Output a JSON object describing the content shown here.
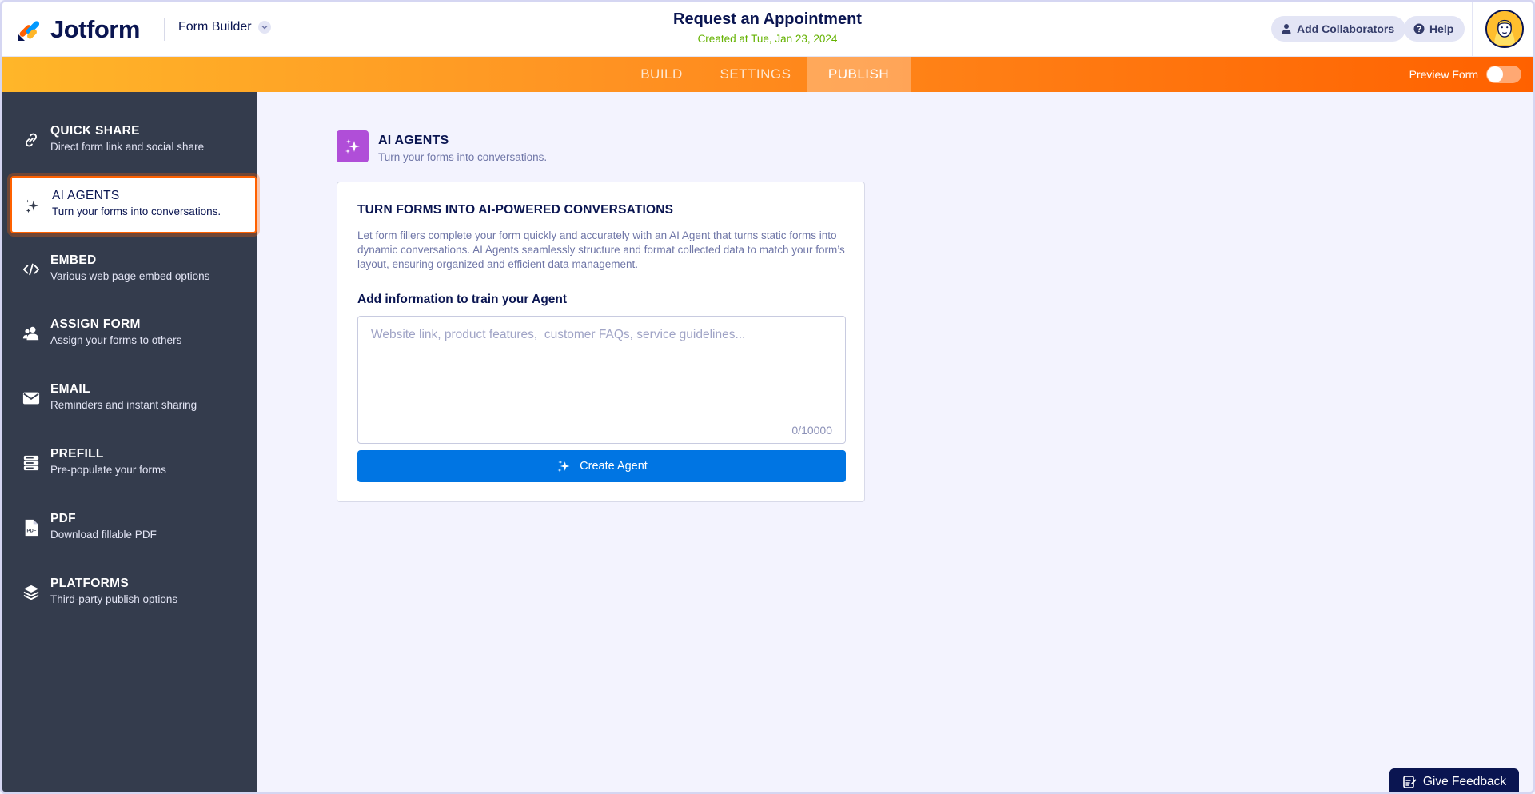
{
  "header": {
    "logo_text": "Jotform",
    "app_switcher": "Form Builder",
    "form_title": "Request an Appointment",
    "form_created": "Created at Tue, Jan 23, 2024",
    "add_collaborators": "Add Collaborators",
    "help": "Help"
  },
  "nav": {
    "tabs": [
      {
        "label": "BUILD",
        "active": false
      },
      {
        "label": "SETTINGS",
        "active": false
      },
      {
        "label": "PUBLISH",
        "active": true
      }
    ],
    "preview_label": "Preview Form",
    "preview_on": false
  },
  "sidebar": {
    "items": [
      {
        "title": "QUICK SHARE",
        "desc": "Direct form link and social share",
        "icon": "link-icon"
      },
      {
        "title": "AI AGENTS",
        "desc": "Turn your forms into conversations.",
        "icon": "sparkle-icon",
        "active": true
      },
      {
        "title": "EMBED",
        "desc": "Various web page embed options",
        "icon": "code-icon"
      },
      {
        "title": "ASSIGN FORM",
        "desc": "Assign your forms to others",
        "icon": "users-icon"
      },
      {
        "title": "EMAIL",
        "desc": "Reminders and instant sharing",
        "icon": "envelope-icon"
      },
      {
        "title": "PREFILL",
        "desc": "Pre-populate your forms",
        "icon": "database-icon"
      },
      {
        "title": "PDF",
        "desc": "Download fillable PDF",
        "icon": "pdf-icon"
      },
      {
        "title": "PLATFORMS",
        "desc": "Third-party publish options",
        "icon": "layers-icon"
      }
    ]
  },
  "main": {
    "section_title": "AI AGENTS",
    "section_subtitle": "Turn your forms into conversations.",
    "card_title": "TURN FORMS INTO AI-POWERED CONVERSATIONS",
    "card_desc": "Let form fillers complete your form quickly and accurately with an AI Agent that turns static forms into dynamic conversations. AI Agents seamlessly structure and format collected data to match your form’s layout, ensuring organized and efficient data management.",
    "train_label": "Add information to train your Agent",
    "train_value": "",
    "train_placeholder": "Website link, product features,  customer FAQs, service guidelines...",
    "char_counter": "0/10000",
    "create_button": "Create Agent"
  },
  "feedback": {
    "label": "Give Feedback"
  },
  "colors": {
    "accent_orange": "#ff6100",
    "primary_blue": "#0075e3",
    "sidebar_bg": "#343c4d",
    "ai_purple": "#b04ed8",
    "created_green": "#64b200"
  }
}
